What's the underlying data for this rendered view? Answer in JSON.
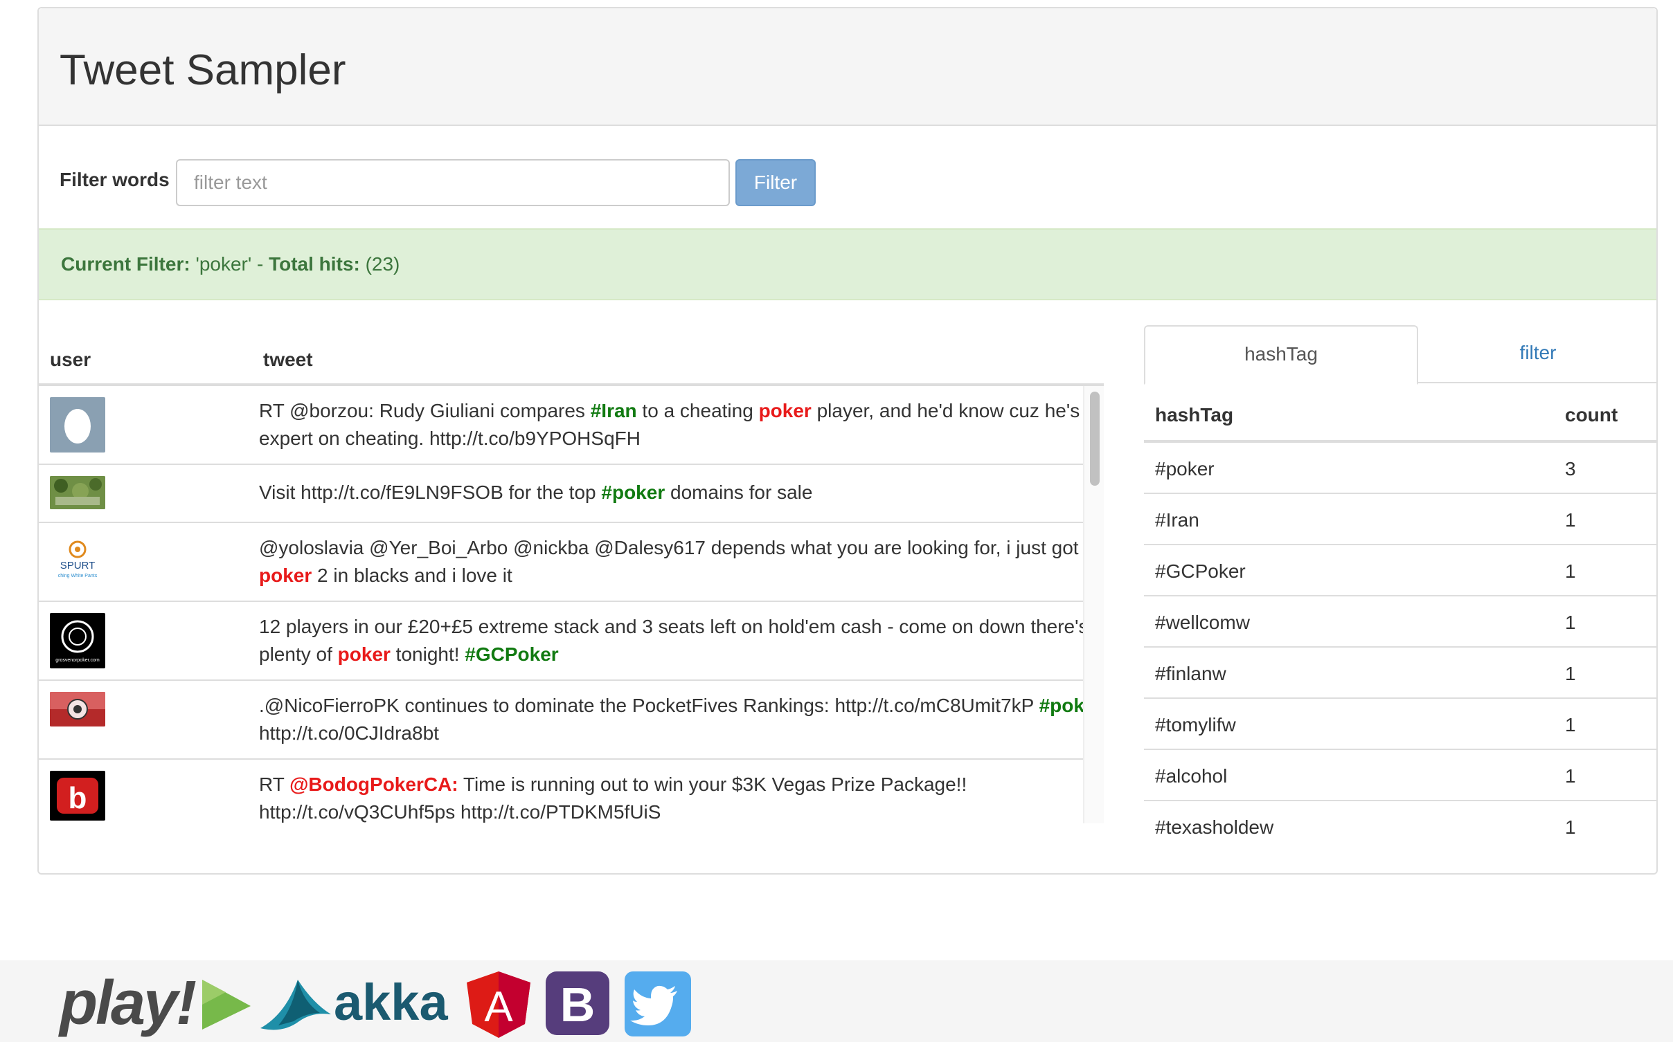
{
  "app": {
    "title": "Tweet Sampler"
  },
  "filter": {
    "label": "Filter words",
    "placeholder": "filter text",
    "value": "",
    "button_label": "Filter"
  },
  "status": {
    "filter_label": "Current Filter:",
    "filter_value": "'poker'",
    "separator": "-",
    "hits_label": "Total hits:",
    "hits_value": "(23)"
  },
  "tweets": {
    "columns": [
      "user",
      "tweet"
    ],
    "rows": [
      {
        "avatar": "egg-avatar",
        "parts": [
          {
            "t": "RT @borzou: Rudy Giuliani compares ",
            "s": ""
          },
          {
            "t": "#Iran",
            "s": "hash"
          },
          {
            "t": " to a cheating ",
            "s": ""
          },
          {
            "t": "poker",
            "s": "hl"
          },
          {
            "t": " player, and he'd know cuz he's an expert on cheating. http://t.co/b9YPOHSqFH",
            "s": ""
          }
        ]
      },
      {
        "avatar": "landscape-avatar",
        "parts": [
          {
            "t": "Visit http://t.co/fE9LN9FSOB for the top ",
            "s": ""
          },
          {
            "t": "#poker",
            "s": "hash"
          },
          {
            "t": " domains for sale",
            "s": ""
          }
        ]
      },
      {
        "avatar": "spurt-logo-avatar",
        "avatar_text": "SPURT",
        "avatar_subtext": "ching White Pants",
        "parts": [
          {
            "t": "@yoloslavia @Yer_Boi_Arbo @nickba @Dalesy617 depends what you are looking for, i just got a ",
            "s": ""
          },
          {
            "t": "poker",
            "s": "hl"
          },
          {
            "t": " 2 in blacks and i love it",
            "s": ""
          }
        ]
      },
      {
        "avatar": "grosvenor-logo-avatar",
        "avatar_text": "grosvenorpoker.com",
        "parts": [
          {
            "t": "12 players in our £20+£5 extreme stack and 3 seats left on hold'em cash - come on down there's plenty of ",
            "s": ""
          },
          {
            "t": "poker",
            "s": "hl"
          },
          {
            "t": " tonight! ",
            "s": ""
          },
          {
            "t": "#GCPoker",
            "s": "hash"
          }
        ]
      },
      {
        "avatar": "red-badge-avatar",
        "parts": [
          {
            "t": ".@NicoFierroPK continues to dominate the PocketFives Rankings: http://t.co/mC8Umit7kP ",
            "s": ""
          },
          {
            "t": "#poker",
            "s": "hash"
          },
          {
            "t": " http://t.co/0CJIdra8bt",
            "s": ""
          }
        ]
      },
      {
        "avatar": "bodog-avatar",
        "avatar_text": "b",
        "parts": [
          {
            "t": "RT ",
            "s": ""
          },
          {
            "t": "@BodogPokerCA:",
            "s": "hl"
          },
          {
            "t": " Time is running out to win your $3K Vegas Prize Package!! http://t.co/vQ3CUhf5ps http://t.co/PTDKM5fUiS",
            "s": ""
          }
        ]
      }
    ]
  },
  "tabs": [
    {
      "label": "hashTag",
      "active": true
    },
    {
      "label": "filter",
      "active": false
    }
  ],
  "hashtags": {
    "columns": [
      "hashTag",
      "count"
    ],
    "rows": [
      {
        "tag": "#poker",
        "count": "3"
      },
      {
        "tag": "#Iran",
        "count": "1"
      },
      {
        "tag": "#GCPoker",
        "count": "1"
      },
      {
        "tag": "#wellcomw",
        "count": "1"
      },
      {
        "tag": "#finlanw",
        "count": "1"
      },
      {
        "tag": "#tomylifw",
        "count": "1"
      },
      {
        "tag": "#alcohol",
        "count": "1"
      },
      {
        "tag": "#texasholdew",
        "count": "1"
      }
    ]
  },
  "footer": {
    "logos": [
      {
        "name": "play-logo",
        "text": "play!"
      },
      {
        "name": "akka-logo",
        "text": "akka"
      },
      {
        "name": "angular-logo",
        "text": "A"
      },
      {
        "name": "bootstrap-logo",
        "text": "B"
      },
      {
        "name": "twitter-logo",
        "text": ""
      }
    ]
  },
  "colors": {
    "hashtag": "#117a11",
    "highlight": "#e81a1a",
    "alert_bg": "#dff0d8",
    "alert_text": "#3c763d",
    "link": "#337ab7",
    "button": "#7ca9d6"
  }
}
